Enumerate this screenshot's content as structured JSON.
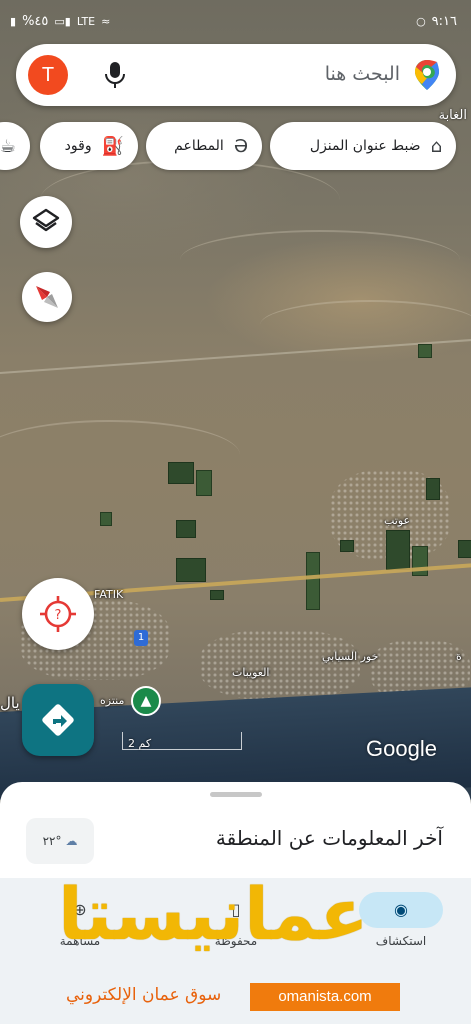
{
  "status_bar": {
    "time": "٩:١٦",
    "battery": "%٤٥",
    "network": "LTE"
  },
  "search": {
    "placeholder": "البحث هنا",
    "avatar_letter": "T"
  },
  "chips": {
    "home": "ضبط عنوان المنزل",
    "restaurants": "المطاعم",
    "fuel": "وقود"
  },
  "map_labels": {
    "top_right": "الغابة",
    "fatik": "FATIK",
    "aweeb": "عوتب",
    "khor": "خور السيابي",
    "aweebat": "العويبات",
    "park": "منتزه",
    "partial_right": "ة",
    "partial_left": "يال",
    "road_number": "1",
    "scale": "2 كم",
    "google": "Google"
  },
  "sheet": {
    "title": "آخر المعلومات عن المنطقة",
    "temperature": "°٢٢"
  },
  "tabs": {
    "explore": "استكشاف",
    "saved": "محفوظة",
    "contribute": "مساهمة"
  },
  "watermark": {
    "arabic": "عمانيستا",
    "subtitle": "سوق عمان الإلكتروني",
    "domain": "omanista.com"
  },
  "colors": {
    "avatar": "#f24a1f",
    "directions_fab": "#0e7482",
    "watermark_yellow": "#f2b705",
    "watermark_orange": "#f07b0d"
  }
}
